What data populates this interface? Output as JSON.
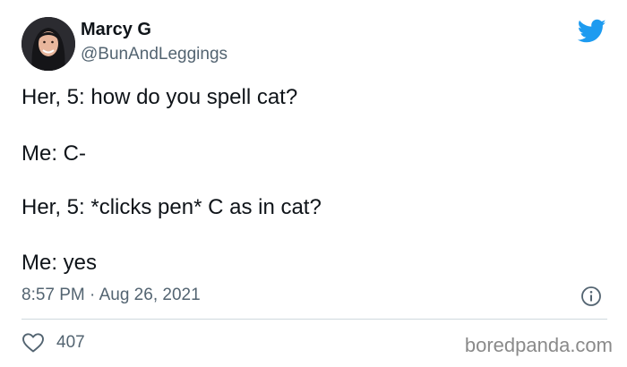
{
  "tweet": {
    "author": {
      "display_name": "Marcy G",
      "handle": "@BunAndLeggings",
      "avatar_icon": "profile-photo"
    },
    "lines": [
      "Her, 5: how do you spell cat?",
      "Me: C-",
      "Her, 5: *clicks pen* C as in cat?",
      "Me: yes"
    ],
    "timestamp": "8:57 PM · Aug 26, 2021",
    "likes": "407"
  },
  "icons": {
    "logo": "twitter-bird-icon",
    "info": "info-icon",
    "like": "heart-icon"
  },
  "watermark": "boredpanda.com",
  "colors": {
    "twitter_blue": "#1d9bf0",
    "text_primary": "#0f1419",
    "text_secondary": "#536471",
    "divider": "#cfd9de"
  }
}
